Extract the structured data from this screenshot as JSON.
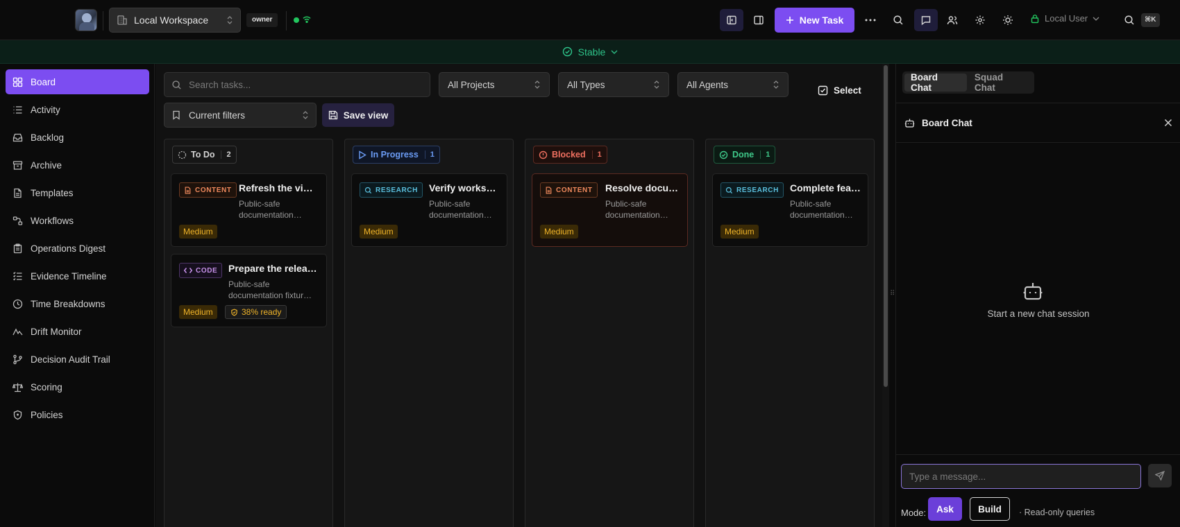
{
  "topbar": {
    "workspace": "Local Workspace",
    "role_badge": "owner",
    "new_task_label": "New Task",
    "user_label": "Local User",
    "shortcut": "⌘K"
  },
  "status_banner": {
    "label": "Stable",
    "color": "#2ec48a"
  },
  "sidebar": {
    "items": [
      {
        "label": "Board",
        "icon": "board-icon",
        "active": true
      },
      {
        "label": "Activity",
        "icon": "activity-list-icon"
      },
      {
        "label": "Backlog",
        "icon": "inbox-icon"
      },
      {
        "label": "Archive",
        "icon": "archive-icon"
      },
      {
        "label": "Templates",
        "icon": "document-icon"
      },
      {
        "label": "Workflows",
        "icon": "workflow-icon"
      },
      {
        "label": "Operations Digest",
        "icon": "clipboard-icon"
      },
      {
        "label": "Evidence Timeline",
        "icon": "timeline-list-icon"
      },
      {
        "label": "Time Breakdowns",
        "icon": "clock-icon"
      },
      {
        "label": "Drift Monitor",
        "icon": "pulse-icon"
      },
      {
        "label": "Decision Audit Trail",
        "icon": "git-branch-icon"
      },
      {
        "label": "Scoring",
        "icon": "scale-icon"
      },
      {
        "label": "Policies",
        "icon": "shield-icon"
      }
    ]
  },
  "filters": {
    "search_placeholder": "Search tasks...",
    "projects": "All Projects",
    "types": "All Types",
    "agents": "All Agents",
    "select_label": "Select",
    "current_filters": "Current filters",
    "save_view": "Save view"
  },
  "columns": [
    {
      "name": "To Do",
      "count": "2",
      "color": "#d5d5d5",
      "cards": [
        {
          "tag": "CONTENT",
          "title": "Refresh the vi…",
          "desc1": "Public-safe",
          "desc2": "documentation…",
          "priority": "Medium"
        },
        {
          "tag": "CODE",
          "title": "Prepare the relea…",
          "desc1": "Public-safe",
          "desc2": "documentation fixtur…",
          "priority": "Medium",
          "ready": "38% ready"
        }
      ]
    },
    {
      "name": "In Progress",
      "count": "1",
      "color": "#6b9cf5",
      "cards": [
        {
          "tag": "RESEARCH",
          "title": "Verify works…",
          "desc1": "Public-safe",
          "desc2": "documentation…",
          "priority": "Medium"
        }
      ]
    },
    {
      "name": "Blocked",
      "count": "1",
      "color": "#f07060",
      "cards": [
        {
          "tag": "CONTENT",
          "title": "Resolve docu…",
          "desc1": "Public-safe",
          "desc2": "documentation…",
          "priority": "Medium"
        }
      ]
    },
    {
      "name": "Done",
      "count": "1",
      "color": "#3fc98a",
      "cards": [
        {
          "tag": "RESEARCH",
          "title": "Complete fea…",
          "desc1": "Public-safe",
          "desc2": "documentation…",
          "priority": "Medium"
        }
      ]
    }
  ],
  "chat": {
    "tabs": [
      "Board Chat",
      "Squad Chat"
    ],
    "title": "Board Chat",
    "empty_text": "Start a new chat session",
    "input_placeholder": "Type a message...",
    "mode_label": "Mode:",
    "mode_ask": "Ask",
    "mode_build": "Build",
    "mode_hint": "· Read-only queries"
  },
  "colors": {
    "accent": "#7c4df1",
    "content_tag": "#f08a5d",
    "code_tag": "#c792ea",
    "research_tag": "#5bc0de",
    "priority": "#f0b429"
  }
}
